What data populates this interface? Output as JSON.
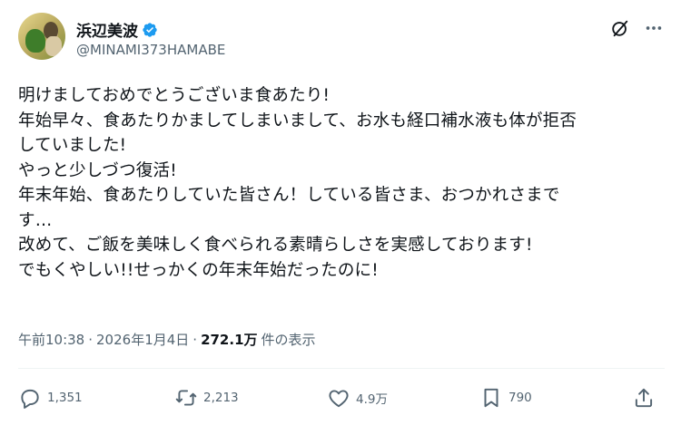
{
  "author": {
    "display_name": "浜辺美波",
    "handle": "@MINAMI373HAMABE"
  },
  "tweet": {
    "lines": [
      "明けましておめでとうございま食あたり!",
      "年始早々、食あたりかましてしまいまして、お水も経口補水液も体が拒否",
      "していました!",
      "やっと少しづつ復活!",
      "年末年始、食あたりしていた皆さん！している皆さま、おつかれさまで",
      "す…",
      "改めて、ご飯を美味しく食べられる素晴らしさを実感しております!",
      "でもくやしい!!せっかくの年末年始だったのに!"
    ]
  },
  "meta": {
    "time": "午前10:38",
    "sep1": "·",
    "date": "2026年1月4日",
    "sep2": "·",
    "views": "272.1万",
    "views_label": "件の表示"
  },
  "actions": {
    "replies": "1,351",
    "reposts": "2,213",
    "likes": "4.9万",
    "bookmarks": "790"
  },
  "colors": {
    "accent": "#1d9bf0",
    "text": "#0f1419",
    "secondary": "#536471",
    "divider": "#eff3f4"
  }
}
